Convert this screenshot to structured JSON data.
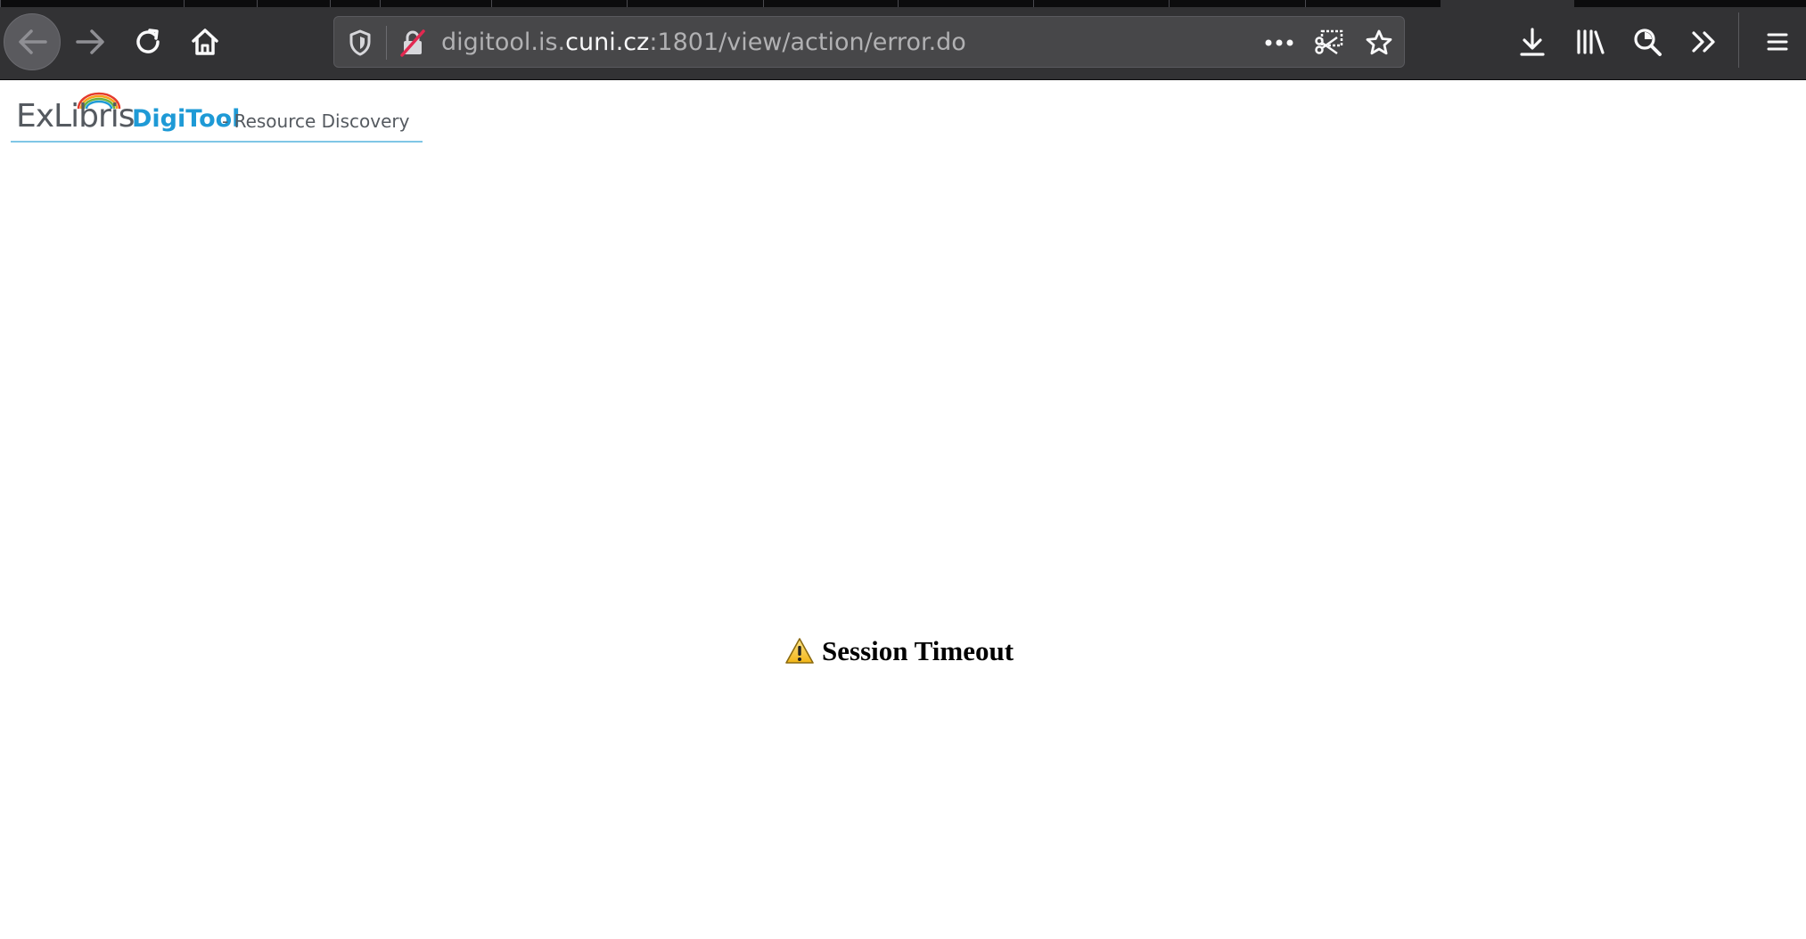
{
  "browser": {
    "url": {
      "prefix": "digitool.is.",
      "host_strong": "cuni.cz",
      "suffix": ":1801/view/action/error.do"
    },
    "icons": {
      "back": "back-arrow-icon",
      "forward": "forward-arrow-icon",
      "reload": "reload-icon",
      "home": "home-icon",
      "tracking_protection": "shield-icon",
      "insecure": "insecure-lock-icon",
      "page_actions": "more-dots-icon",
      "screenshot": "screenshot-icon",
      "bookmark": "star-icon",
      "downloads": "download-icon",
      "library": "library-icon",
      "zoom": "magnifier-icon",
      "overflow": "double-chevron-icon",
      "menu": "hamburger-menu-icon"
    },
    "colors": {
      "toolbar": "#323234",
      "urlbar": "#474749",
      "insecure_slash": "#e22850"
    }
  },
  "page": {
    "logo": {
      "brand": "ExLibris",
      "product": "DigiTool",
      "tagline": "- Resource Discovery",
      "colors": {
        "brand": "#555a60",
        "product": "#1e9ad6",
        "underline": "#7fc6e6"
      }
    },
    "message": {
      "icon": "warning-icon",
      "text": "Session Timeout"
    }
  }
}
